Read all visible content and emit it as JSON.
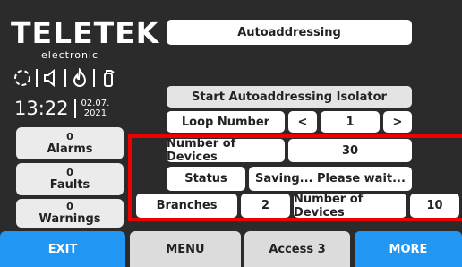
{
  "brand": {
    "name": "TELETEK",
    "tagline": "electronic"
  },
  "status_icons": [
    "power-icon",
    "speaker-icon",
    "fire-icon",
    "extinguisher-icon"
  ],
  "clock": {
    "time": "13:22",
    "date_day": "02.07.",
    "date_year": "2021"
  },
  "counters": [
    {
      "count": "0",
      "label": "Alarms"
    },
    {
      "count": "0",
      "label": "Faults"
    },
    {
      "count": "0",
      "label": "Warnings"
    }
  ],
  "screen": {
    "title": "Autoaddressing",
    "start_button": "Start Autoaddressing Isolator",
    "loop": {
      "label": "Loop Number",
      "prev": "<",
      "value": "1",
      "next": ">"
    },
    "devices": {
      "label": "Number of Devices",
      "value": "30"
    },
    "status": {
      "label": "Status",
      "value": "Saving... Please wait..."
    },
    "branches": {
      "label": "Branches",
      "value": "2",
      "devices_label": "Number of Devices",
      "devices_value": "10"
    }
  },
  "bottom_bar": {
    "exit": "EXIT",
    "menu": "MENU",
    "access": "Access 3",
    "more": "MORE"
  },
  "colors": {
    "background": "#2b2b2b",
    "accent_blue": "#2196f3",
    "highlight_red": "#ee0000"
  }
}
